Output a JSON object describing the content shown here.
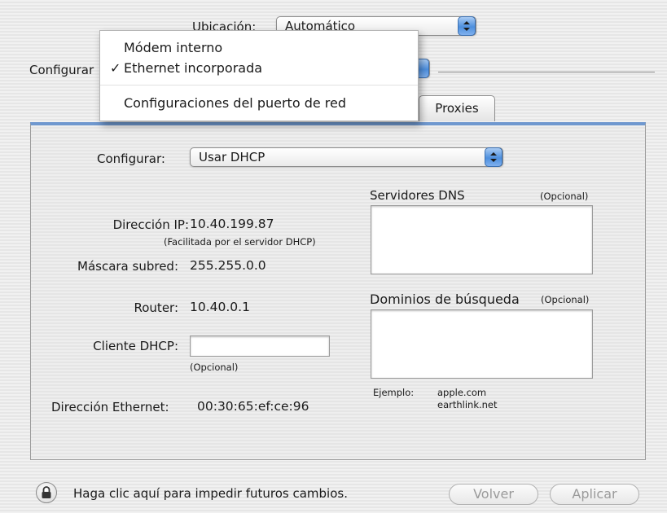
{
  "header": {
    "location_label": "Ubicación:",
    "location_value": "Automático",
    "show_label": "Configurar"
  },
  "tabs": {
    "proxies_label": "Proxies"
  },
  "port_menu": {
    "items": [
      {
        "label": "Módem interno",
        "checked": false
      },
      {
        "label": "Ethernet incorporada",
        "checked": true
      },
      {
        "label": "Configuraciones del puerto de red",
        "checked": false
      }
    ],
    "check_mark": "✓"
  },
  "tcpip": {
    "configure_label": "Configurar:",
    "configure_value": "Usar DHCP",
    "ip_label": "Dirección IP:",
    "ip_value": "10.40.199.87",
    "ip_note": "(Facilitada por el servidor DHCP)",
    "subnet_label": "Máscara subred:",
    "subnet_value": "255.255.0.0",
    "router_label": "Router:",
    "router_value": "10.40.0.1",
    "dhcp_client_label": "Cliente DHCP:",
    "dhcp_client_value": "",
    "dhcp_client_note": "(Opcional)",
    "ethernet_label": "Dirección Ethernet:",
    "ethernet_value": "00:30:65:ef:ce:96",
    "dns_label": "Servidores DNS",
    "dns_optional": "(Opcional)",
    "dns_value": "",
    "search_label": "Dominios de búsqueda",
    "search_optional": "(Opcional)",
    "search_value": "",
    "example_label": "Ejemplo:",
    "example_line1": "apple.com",
    "example_line2": "earthlink.net"
  },
  "footer": {
    "lock_text": "Haga clic aquí para impedir futuros cambios.",
    "revert_label": "Volver",
    "apply_label": "Aplicar"
  },
  "colors": {
    "accent_blue": "#4d8fde",
    "panel_top_border": "#6f98cf"
  }
}
